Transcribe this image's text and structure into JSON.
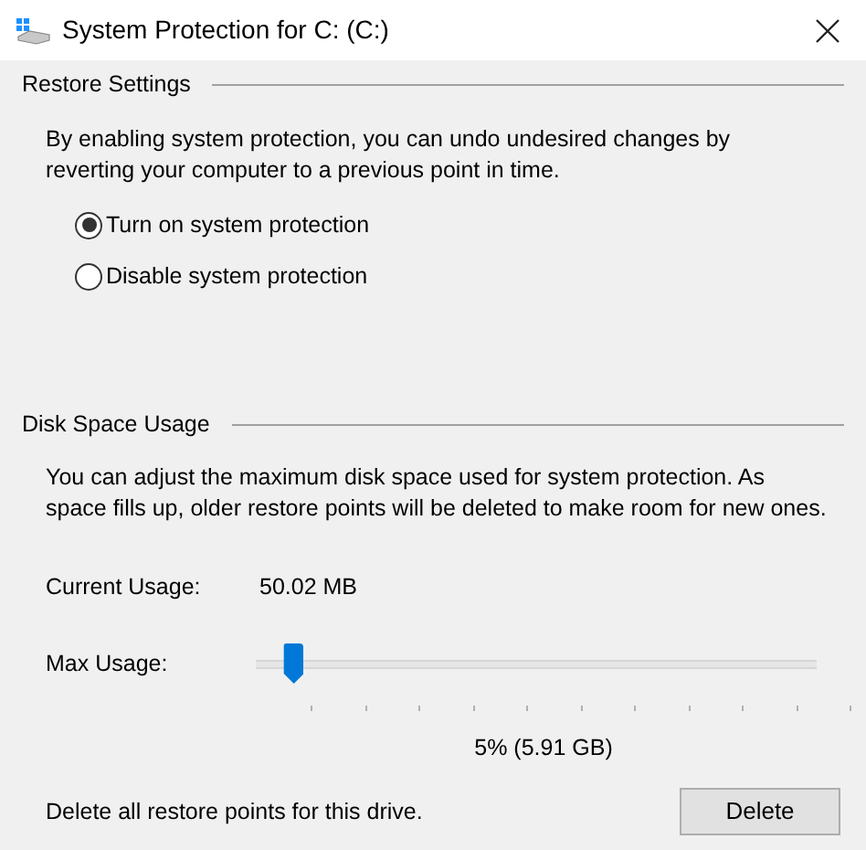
{
  "window": {
    "title": "System Protection for C: (C:)"
  },
  "restore_settings": {
    "heading": "Restore Settings",
    "description": "By enabling system protection, you can undo undesired changes by reverting your computer to a previous point in time.",
    "options": [
      {
        "label": "Turn on system protection",
        "selected": true
      },
      {
        "label": "Disable system protection",
        "selected": false
      }
    ]
  },
  "disk_space_usage": {
    "heading": "Disk Space Usage",
    "description": "You can adjust the maximum disk space used for system protection. As space fills up, older restore points will be deleted to make room for new ones.",
    "current_usage_label": "Current Usage:",
    "current_usage_value": "50.02 MB",
    "max_usage_label": "Max Usage:",
    "max_usage": {
      "level": 0.05
    },
    "max_usage_reading": "5% (5.91 GB)",
    "delete_text": "Delete all restore points for this drive.",
    "delete_button": "Delete"
  }
}
